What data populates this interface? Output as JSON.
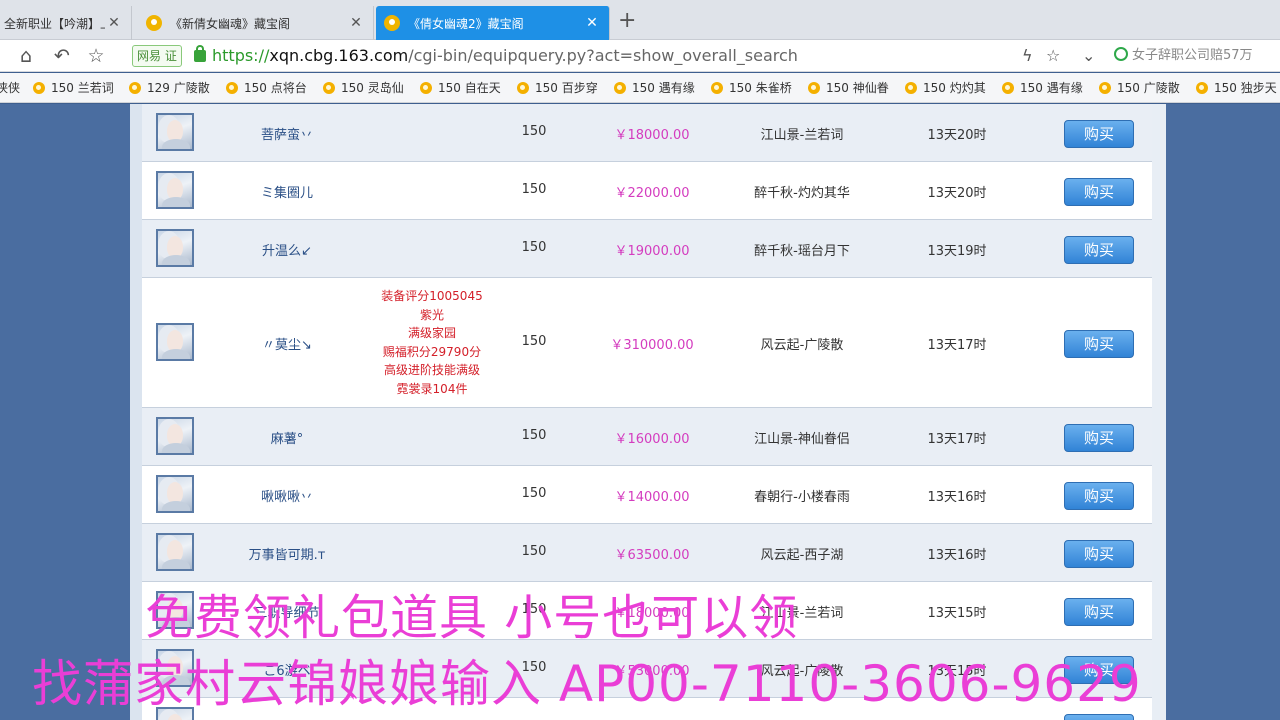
{
  "browser": {
    "tabs": [
      {
        "label": "全新职业【吟潮】上",
        "active": false
      },
      {
        "label": "《新倩女幽魂》藏宝阁",
        "active": false
      },
      {
        "label": "《倩女幽魂2》藏宝阁",
        "active": true
      }
    ],
    "new_tab_label": "+",
    "address": {
      "badge": "网易 证",
      "scheme": "https://",
      "host": "xqn.cbg.163.com",
      "path": "/cgi-bin/equipquery.py?act=show_overall_search"
    },
    "search_hint": "女子辞职公司赔57万",
    "bookmarks": [
      "侠侠",
      "150 兰若词",
      "129 广陵散",
      "150 点将台",
      "150 灵岛仙",
      "150 自在天",
      "150 百步穿",
      "150 遇有缘",
      "150 朱雀桥",
      "150 神仙眷",
      "150 灼灼其",
      "150 遇有缘",
      "150 广陵散",
      "150 独步天"
    ]
  },
  "listing": {
    "buy_label": "购买",
    "rows": [
      {
        "name": "菩萨蛮丷",
        "desc": [],
        "level": "150",
        "price": "￥18000.00",
        "server": "江山景-兰若词",
        "time": "13天20时"
      },
      {
        "name": "ミ集圈儿",
        "desc": [],
        "level": "150",
        "price": "￥22000.00",
        "server": "醉千秋-灼灼其华",
        "time": "13天20时"
      },
      {
        "name": "升温么↙",
        "desc": [],
        "level": "150",
        "price": "￥19000.00",
        "server": "醉千秋-瑶台月下",
        "time": "13天19时"
      },
      {
        "name": "〃莫尘↘",
        "desc": [
          "装备评分1005045",
          "紫光",
          "满级家园",
          "赐福积分29790分",
          "高级进阶技能满级",
          "霓裳录104件"
        ],
        "level": "150",
        "price": "￥310000.00",
        "server": "风云起-广陵散",
        "time": "13天17时"
      },
      {
        "name": "麻薯°",
        "desc": [],
        "level": "150",
        "price": "￥16000.00",
        "server": "江山景-神仙眷侣",
        "time": "13天17时"
      },
      {
        "name": "啾啾啾丷",
        "desc": [],
        "level": "150",
        "price": "￥14000.00",
        "server": "春朝行-小楼春雨",
        "time": "13天16时"
      },
      {
        "name": "万事皆可期.т",
        "desc": [],
        "level": "150",
        "price": "￥63500.00",
        "server": "风云起-西子湖",
        "time": "13天16时"
      },
      {
        "name": "三职导细节",
        "desc": [],
        "level": "150",
        "price": "￥18000.00",
        "server": "江山景-兰若词",
        "time": "13天15时"
      },
      {
        "name": "こ6游ベ",
        "desc": [],
        "level": "150",
        "price": "￥53000.00",
        "server": "风云起-广陵散",
        "time": "13天15时"
      }
    ]
  },
  "overlay": {
    "line1": "免费领礼包道具 小号也可以领",
    "line2": "找蒲家村云锦娘娘输入 AP00-7110-3606-9629",
    "color": "#ea3ed6"
  }
}
